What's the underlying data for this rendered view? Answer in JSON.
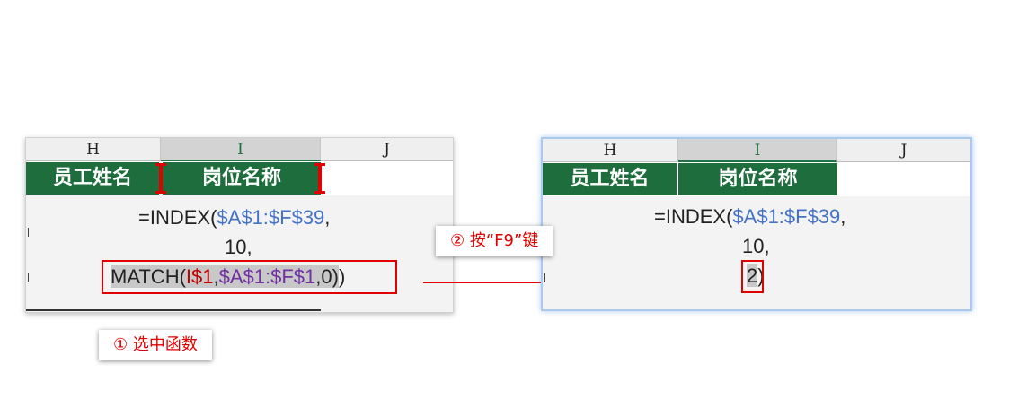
{
  "columns": [
    "H",
    "I",
    "J"
  ],
  "headers": [
    "员工姓名",
    "岗位名称"
  ],
  "left": {
    "line1": {
      "prefix": "=INDEX(",
      "range": "$A$1:$F$39",
      "suffix": ","
    },
    "line2": "10,",
    "line3": {
      "fn": "MATCH(",
      "arg1": "I$1",
      "comma1": ",",
      "arg2": "$A$1:$F$1",
      "comma2": ",",
      "arg3": "0",
      "close_inner": ")",
      "close_outer": ")"
    }
  },
  "right": {
    "line1": {
      "prefix": "=INDEX(",
      "range": "$A$1:$F$39",
      "suffix": ","
    },
    "line2": "10,",
    "line3": {
      "value": "2",
      "close": ")"
    }
  },
  "callouts": {
    "step1": "① 选中函数",
    "step2": "② 按“F9”键"
  },
  "colors": {
    "header_green": "#1e6e3d",
    "annotation_red": "#e00000",
    "reference_blue": "#4472c4",
    "reference_red": "#c00000",
    "reference_purple": "#7030a0"
  }
}
